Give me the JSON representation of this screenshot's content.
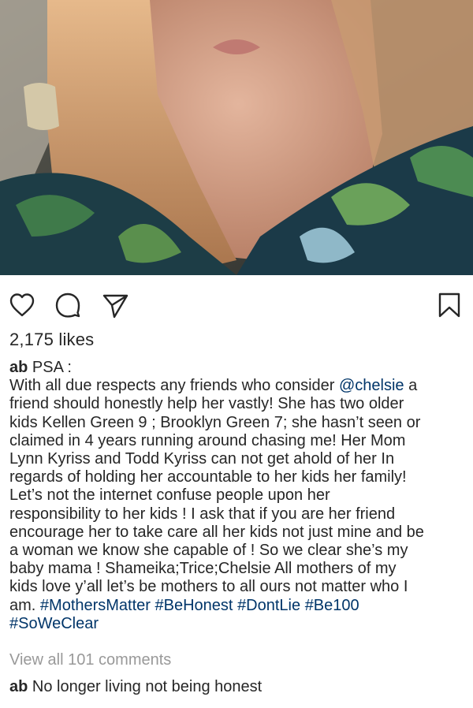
{
  "post": {
    "likes": "2,175 likes",
    "caption": {
      "username": "ab",
      "title": "PSA :",
      "line1_prefix": "With all due respects any friends who consider ",
      "mention": "@chelsie",
      "line1_suffix": " a",
      "lines": [
        "friend should honestly help her vastly! She has two older",
        "kids Kellen Green 9 ; Brooklyn Green 7;  she hasn’t seen or",
        "claimed in 4 years running around chasing me! Her Mom",
        "Lynn Kyriss and Todd Kyriss can not get ahold of her In",
        "regards of holding her accountable to her kids her family!",
        "Let’s not the internet confuse people upon her",
        "responsibility to her kids ! I ask that if you are her friend",
        "encourage her to take care all her kids not just mine and be",
        "a woman we know she capable of ! So we clear she’s my",
        "baby mama ! Shameika;Trice;Chelsie  All mothers of my",
        "kids love y’all let’s be mothers to all ours not matter who I"
      ],
      "last_line_prefix": "am. ",
      "hashtags": [
        "#MothersMatter",
        "#BeHonest",
        "#DontLie",
        "#Be100"
      ],
      "hashtag_last": "#SoWeClear"
    },
    "view_comments": "View all 101 comments",
    "comment": {
      "username": "ab",
      "text": "No longer living not being honest"
    }
  },
  "icons": {
    "heart": "heart-icon",
    "comment": "comment-icon",
    "share": "share-icon",
    "save": "bookmark-icon"
  },
  "colors": {
    "text": "#262626",
    "link": "#003569",
    "muted": "#999999"
  }
}
